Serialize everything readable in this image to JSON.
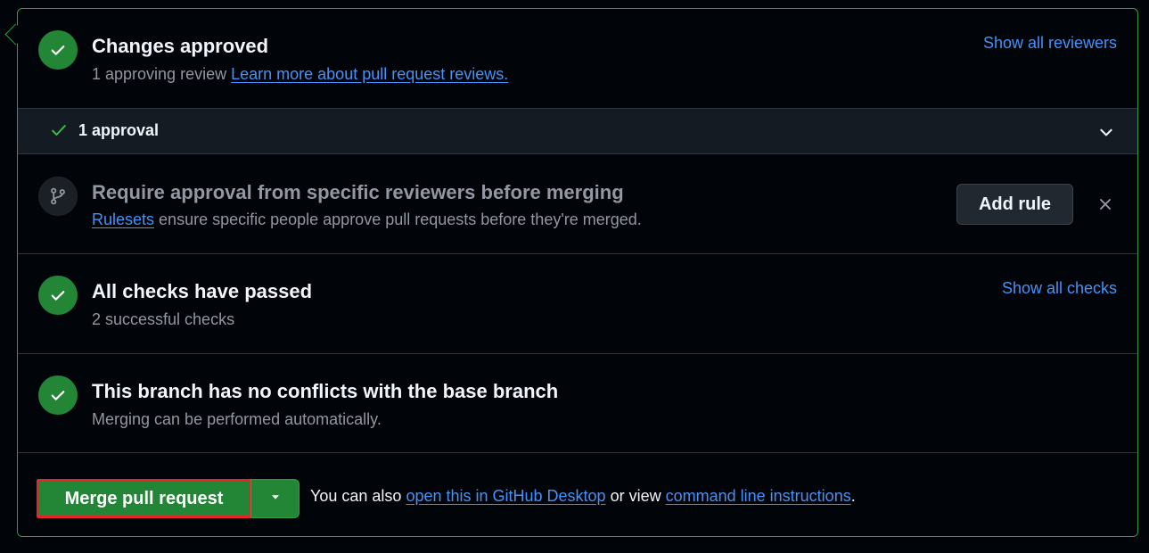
{
  "reviews": {
    "title": "Changes approved",
    "subtitle_text": "1 approving review",
    "subtitle_link": "Learn more about pull request reviews.",
    "show_all_link": "Show all reviewers",
    "icon": "check-icon"
  },
  "approvals": {
    "label": "1 approval",
    "icon": "check-icon",
    "toggle_icon": "chevron-down-icon"
  },
  "ruleset": {
    "title": "Require approval from specific reviewers before merging",
    "link": "Rulesets",
    "text": "ensure specific people approve pull requests before they're merged.",
    "button_label": "Add rule",
    "icon": "git-branch-icon",
    "dismiss_icon": "close-icon"
  },
  "checks": {
    "title": "All checks have passed",
    "subtitle": "2 successful checks",
    "show_all_link": "Show all checks",
    "icon": "check-icon"
  },
  "conflicts": {
    "title": "This branch has no conflicts with the base branch",
    "subtitle": "Merging can be performed automatically.",
    "icon": "check-icon"
  },
  "footer": {
    "merge_label": "Merge pull request",
    "dropdown_icon": "triangle-down-icon",
    "text_prefix": "You can also",
    "desktop_link": "open this in GitHub Desktop",
    "text_middle": "or view",
    "cli_link": "command line instructions",
    "text_suffix": "."
  },
  "colors": {
    "success": "#238636",
    "link": "#4493f8",
    "highlight": "#e5252a",
    "background": "#010409"
  }
}
